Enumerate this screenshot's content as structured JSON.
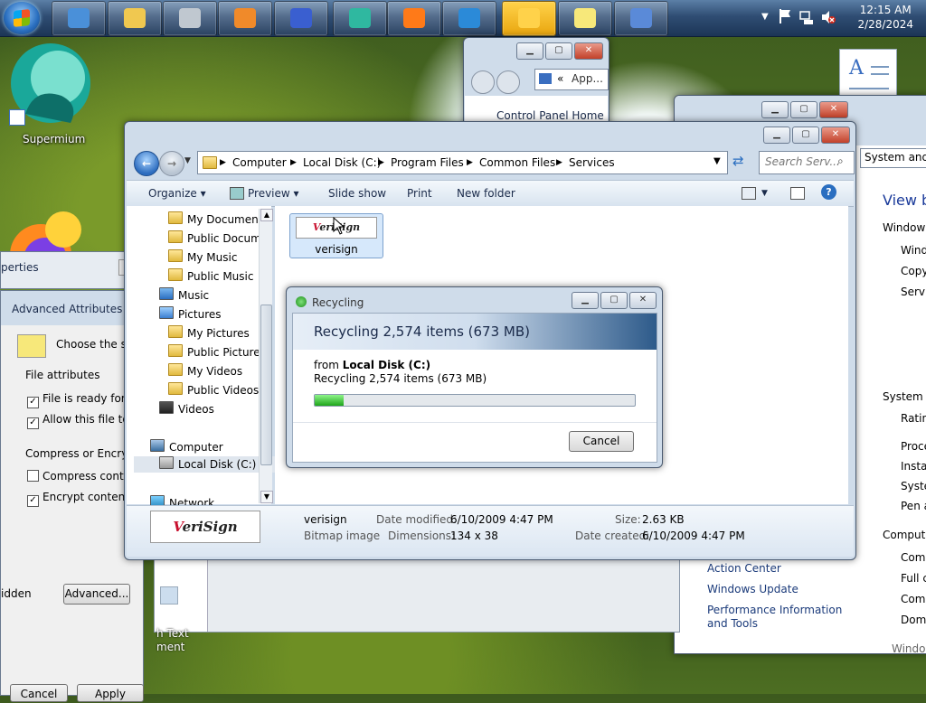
{
  "taskbar": {
    "clock_time": "12:15 AM",
    "clock_date": "2/28/2024",
    "buttons": [
      {
        "name": "remote-desktop",
        "color": "#4a90d9"
      },
      {
        "name": "file-explorer",
        "color": "#f0c850"
      },
      {
        "name": "calculator",
        "color": "#c0c8d0"
      },
      {
        "name": "media-player",
        "color": "#f08a2a"
      },
      {
        "name": "infinity-app",
        "color": "#3a5fd0"
      },
      {
        "name": "supermium",
        "color": "#2fb8a0"
      },
      {
        "name": "firefox",
        "color": "#ff7a18"
      },
      {
        "name": "internet-explorer",
        "color": "#2b8ad8"
      },
      {
        "name": "windows-flag",
        "color": "#ffd24a"
      },
      {
        "name": "sticky-notes",
        "color": "#f7e87a"
      },
      {
        "name": "wordpad",
        "color": "#5a8ad8"
      }
    ]
  },
  "desktop": {
    "supermium_label": "Supermium"
  },
  "control_panel_window": {
    "address_text": "App...",
    "home_link": "Control Panel Home"
  },
  "system_window": {
    "address_text": "System and S",
    "heading": "View ba",
    "section_windows": "Windows",
    "windows_items": [
      "Wind",
      "Copy",
      "Servic"
    ],
    "section_system": "System",
    "system_items": [
      "Rating",
      "Proce",
      "Instal",
      "Syster",
      "Pen a"
    ],
    "section_computer": "Compute",
    "computer_items": [
      "Comp",
      "Full c",
      "Comp",
      "Doma"
    ],
    "see_also": [
      "Action Center",
      "Windows Update",
      "Performance Information and Tools"
    ],
    "bottom_cut": "Windo"
  },
  "properties_window": {
    "title": "perties"
  },
  "advanced_attributes": {
    "title": "Advanced Attributes",
    "choose_text": "Choose the sett",
    "file_attributes": "File attributes",
    "check_archive": "File is ready for arc",
    "check_index": "Allow this file to ha",
    "compress_group": "Compress or Encrypt a",
    "check_compress": "Compress contents",
    "check_encrypt": "Encrypt contents to",
    "hidden_text": "idden",
    "advanced_button": "Advanced...",
    "cancel_button": "Cancel",
    "apply_button": "Apply"
  },
  "wordpad_window": {
    "label_line1": "h Text",
    "label_line2": "ment"
  },
  "explorer": {
    "breadcrumbs": [
      "Computer",
      "Local Disk (C:)",
      "Program Files",
      "Common Files",
      "Services"
    ],
    "search_placeholder": "Search Serv...",
    "toolbar": {
      "organize": "Organize",
      "preview": "Preview",
      "slideshow": "Slide show",
      "print": "Print",
      "new_folder": "New folder"
    },
    "nav": [
      {
        "label": "My Documents",
        "type": "folder"
      },
      {
        "label": "Public Docume",
        "type": "folder"
      },
      {
        "label": "My Music",
        "type": "folder"
      },
      {
        "label": "Public Music",
        "type": "folder"
      },
      {
        "label": "Music",
        "type": "music"
      },
      {
        "label": "Pictures",
        "type": "pictures"
      },
      {
        "label": "My Pictures",
        "type": "folder"
      },
      {
        "label": "Public Pictures",
        "type": "folder"
      },
      {
        "label": "My Videos",
        "type": "folder"
      },
      {
        "label": "Public Videos",
        "type": "folder"
      },
      {
        "label": "Videos",
        "type": "videos"
      },
      {
        "label": "Computer",
        "type": "computer"
      },
      {
        "label": "Local Disk (C:)",
        "type": "disk"
      },
      {
        "label": "Network",
        "type": "network"
      }
    ],
    "file": {
      "thumb_text_pre": "V",
      "thumb_text_post": "eriSign",
      "name": "verisign"
    },
    "details": {
      "name": "verisign",
      "type": "Bitmap image",
      "date_modified_label": "Date modified:",
      "date_modified": "6/10/2009 4:47 PM",
      "dimensions_label": "Dimensions:",
      "dimensions": "134 x 38",
      "size_label": "Size:",
      "size": "2.63 KB",
      "date_created_label": "Date created:",
      "date_created": "6/10/2009 4:47 PM"
    }
  },
  "recycling_dialog": {
    "title": "Recycling",
    "headline": "Recycling 2,574 items (673 MB)",
    "from_label": "from",
    "from_value": "Local Disk (C:)",
    "subline": "Recycling 2,574 items (673 MB)",
    "progress_fraction": 0.09,
    "cancel_button": "Cancel"
  }
}
